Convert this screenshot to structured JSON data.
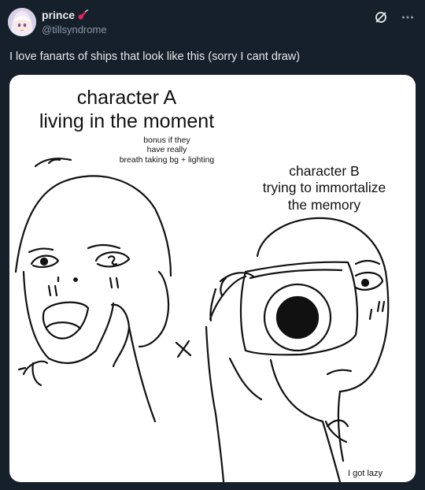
{
  "user": {
    "display_name": "prince",
    "handle": "@tillsyndrome",
    "avatar_icon": "anime-avatar-icon",
    "name_emoji_icon": "guitar-emoji-icon"
  },
  "post": {
    "text": "I love fanarts of ships that look like this (sorry I cant draw)"
  },
  "toolbar": {
    "icons": [
      "grok-slash-icon",
      "more-options-icon"
    ]
  },
  "image": {
    "title_a_line1": "character A",
    "title_a_line2": "living in the moment",
    "note_a_line1": "bonus if they",
    "note_a_line2": "have really",
    "note_a_line3": "breath taking bg + lighting",
    "title_b_line1": "character B",
    "title_b_line2": "trying to immortalize",
    "title_b_line3": "the memory",
    "x_mark": "×",
    "footer_note": "I got lazy"
  },
  "colors": {
    "background": "#15202b",
    "text": "#e7e9ea",
    "muted": "#8b98a5",
    "emoji_red": "#e0245e"
  }
}
